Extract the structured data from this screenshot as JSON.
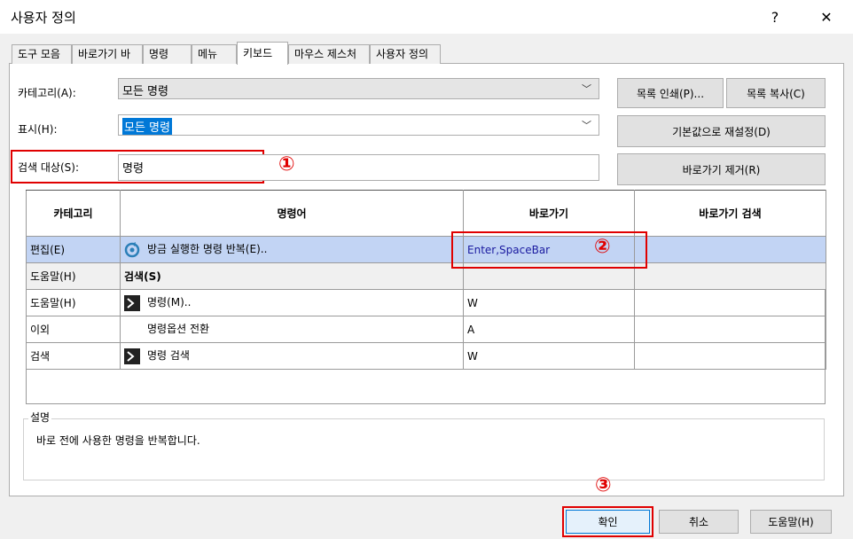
{
  "window": {
    "title": "사용자 정의",
    "help": "?",
    "close": "✕"
  },
  "tabs": [
    "도구 모음",
    "바로가기 바",
    "명령",
    "메뉴",
    "키보드",
    "마우스 제스처",
    "사용자 정의"
  ],
  "form": {
    "category_label": "카테고리(A):",
    "category_value": "모든 명령",
    "display_label": "표시(H):",
    "display_value": "모든 명령",
    "search_label": "검색 대상(S):",
    "search_value": "명령"
  },
  "buttons": {
    "print_list": "목록 인쇄(P)...",
    "copy_list": "목록 복사(C)",
    "reset": "기본값으로 재설정(D)",
    "remove_shortcut": "바로가기 제거(R)",
    "ok": "확인",
    "cancel": "취소",
    "help": "도움말(H)"
  },
  "table": {
    "headers": [
      "카테고리",
      "명령어",
      "바로가기",
      "바로가기 검색"
    ],
    "rows": [
      {
        "category": "편집(E)",
        "icon": "repeat-icon",
        "command": "방금 실행한 명령 반복(E)..",
        "shortcut": "Enter,SpaceBar",
        "search": ""
      },
      {
        "category": "도움말(H)",
        "icon": "",
        "command": "검색(S)",
        "shortcut": "",
        "search": ""
      },
      {
        "category": "도움말(H)",
        "icon": "command-prompt-icon",
        "command": "명령(M)..",
        "shortcut": "W",
        "search": ""
      },
      {
        "category": "이외",
        "icon": "",
        "command": "명령옵션 전환",
        "shortcut": "A",
        "search": ""
      },
      {
        "category": "검색",
        "icon": "command-prompt-icon",
        "command": "명령 검색",
        "shortcut": "W",
        "search": ""
      }
    ]
  },
  "description": {
    "legend": "설명",
    "text": "바로 전에 사용한 명령을 반복합니다."
  },
  "annotations": {
    "one": "①",
    "two": "②",
    "three": "③"
  },
  "colors": {
    "selection": "#c2d4f4",
    "highlight": "#0078d7",
    "annotation": "#e00000",
    "shortcut_text": "#1a1aa0"
  }
}
